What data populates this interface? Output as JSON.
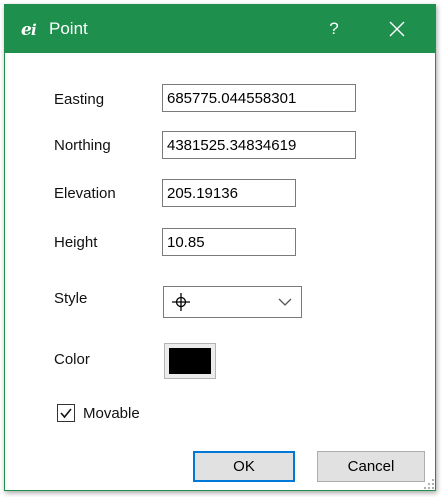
{
  "window": {
    "title": "Point",
    "help_label": "?",
    "app_icon": "app-logo-icon",
    "close_icon": "close-icon",
    "title_bar_color": "#1e8f4c"
  },
  "form": {
    "easting": {
      "label": "Easting",
      "value": "685775.044558301"
    },
    "northing": {
      "label": "Northing",
      "value": "4381525.34834619"
    },
    "elevation": {
      "label": "Elevation",
      "value": "205.19136"
    },
    "height": {
      "label": "Height",
      "value": "10.85"
    },
    "style": {
      "label": "Style",
      "selected_icon": "crosshair-icon",
      "dropdown_icon": "chevron-down-icon"
    },
    "color": {
      "label": "Color",
      "value": "#000000"
    },
    "movable": {
      "label": "Movable",
      "checked": true
    }
  },
  "buttons": {
    "ok": "OK",
    "cancel": "Cancel"
  }
}
